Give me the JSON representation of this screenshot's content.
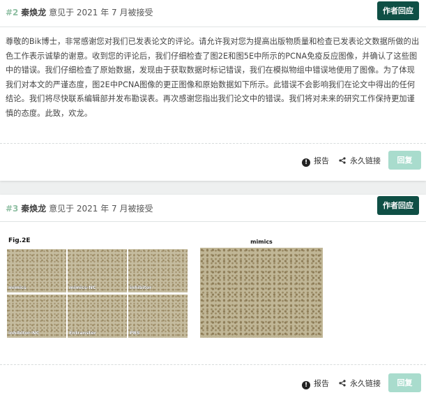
{
  "comments": [
    {
      "number": "#2",
      "author": "秦焕龙",
      "date_text": "意见于 2021 年 7 月被接受",
      "badge": "作者回应",
      "body": "尊敬的Bik博士，非常感谢您对我们已发表论文的评论。请允许我对您为提高出版物质量和检查已发表论文数据所做的出色工作表示诚挚的谢意。收到您的评论后，我们仔细检查了图2E和图5E中所示的PCNA免疫反应图像，并确认了这些图中的错误。我们仔细检查了原始数据，发现由于获取数据时标记错误，我们在模拟物组中错误地使用了图像。为了体现我们对本文的严谨态度，图2E中PCNA图像的更正图像和原始数据如下所示。此错误不会影响我们在论文中得出的任何结论。我们将尽快联系编辑部并发布勘误表。再次感谢您指出我们论文中的错误。我们将对未来的研究工作保持更加谨慎的态度。此致，欢龙。",
      "actions": {
        "report": "报告",
        "permalink": "永久链接",
        "reply": "回复"
      }
    },
    {
      "number": "#3",
      "author": "秦焕龙",
      "date_text": "意见于 2021 年 7 月被接受",
      "badge": "作者回应",
      "figure_label": "Fig.2E",
      "panels": [
        "mimics",
        "mimics-NC",
        "inhibitor",
        "inhibitor-NC",
        "Entranster",
        "PBS"
      ],
      "figure2_label": "mimics",
      "actions": {
        "report": "报告",
        "permalink": "永久链接",
        "reply": "回复"
      }
    }
  ],
  "icons": {
    "report": "alert-circle-icon",
    "permalink": "share-icon"
  }
}
